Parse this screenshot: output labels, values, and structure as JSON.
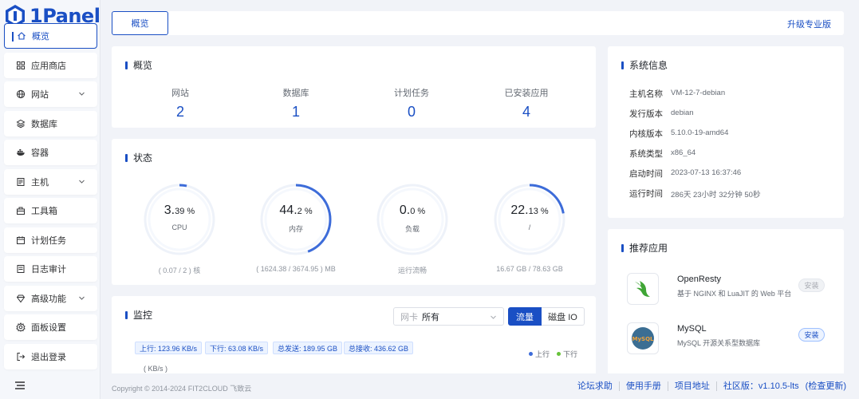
{
  "brand": {
    "name": "1Panel"
  },
  "sidebar": {
    "items": [
      {
        "label": "概览",
        "icon": "home-icon",
        "active": true
      },
      {
        "label": "应用商店",
        "icon": "grid-icon"
      },
      {
        "label": "网站",
        "icon": "globe-icon",
        "expandable": true
      },
      {
        "label": "数据库",
        "icon": "layers-icon"
      },
      {
        "label": "容器",
        "icon": "docker-icon"
      },
      {
        "label": "主机",
        "icon": "host-icon",
        "expandable": true
      },
      {
        "label": "工具箱",
        "icon": "toolbox-icon"
      },
      {
        "label": "计划任务",
        "icon": "calendar-icon"
      },
      {
        "label": "日志审计",
        "icon": "log-icon"
      },
      {
        "label": "高级功能",
        "icon": "diamond-icon",
        "expandable": true
      },
      {
        "label": "面板设置",
        "icon": "gear-icon"
      },
      {
        "label": "退出登录",
        "icon": "logout-icon"
      }
    ]
  },
  "topbar": {
    "tab": "概览",
    "upgrade": "升级专业版"
  },
  "overview": {
    "title": "概览",
    "stats": [
      {
        "label": "网站",
        "value": "2"
      },
      {
        "label": "数据库",
        "value": "1"
      },
      {
        "label": "计划任务",
        "value": "0"
      },
      {
        "label": "已安装应用",
        "value": "4"
      }
    ]
  },
  "status": {
    "title": "状态",
    "gauges": [
      {
        "int": "3.",
        "dec": "39",
        "unit": " %",
        "percent": 3.39,
        "name": "CPU",
        "foot": "( 0.07 / 2 ) 核"
      },
      {
        "int": "44.",
        "dec": "2",
        "unit": " %",
        "percent": 44.2,
        "name": "内存",
        "foot": "( 1624.38 / 3674.95 ) MB"
      },
      {
        "int": "0.",
        "dec": "0",
        "unit": " %",
        "percent": 0,
        "name": "负载",
        "foot": "运行流畅"
      },
      {
        "int": "22.",
        "dec": "13",
        "unit": " %",
        "percent": 22.13,
        "name": "/",
        "foot": "16.67 GB / 78.63 GB"
      }
    ]
  },
  "monitor": {
    "title": "监控",
    "nic_label": "网卡",
    "nic_value": "所有",
    "btn_traffic": "流量",
    "btn_disk": "磁盘 IO",
    "tags": [
      "上行: 123.96 KB/s",
      "下行: 63.08 KB/s",
      "总发送: 189.95 GB",
      "总接收: 436.62 GB"
    ],
    "legend_up": "上行",
    "legend_down": "下行",
    "unit": "( KB/s )",
    "colors": {
      "up": "#3d6cd9",
      "down": "#67c23a"
    }
  },
  "sysinfo": {
    "title": "系统信息",
    "rows": [
      {
        "key": "主机名称",
        "value": "VM-12-7-debian"
      },
      {
        "key": "发行版本",
        "value": "debian"
      },
      {
        "key": "内核版本",
        "value": "5.10.0-19-amd64"
      },
      {
        "key": "系统类型",
        "value": "x86_64"
      },
      {
        "key": "启动时间",
        "value": "2023-07-13 16:37:46"
      },
      {
        "key": "运行时间",
        "value": "286天 23小时 32分钟 50秒"
      }
    ]
  },
  "recommend": {
    "title": "推荐应用",
    "apps": [
      {
        "name": "OpenResty",
        "desc": "基于 NGINX 和 LuaJIT 的 Web 平台",
        "button": "安装",
        "icon": "openresty-icon",
        "disabled": true
      },
      {
        "name": "MySQL",
        "desc": "MySQL 开源关系型数据库",
        "button": "安装",
        "icon": "mysql-icon",
        "disabled": false
      }
    ]
  },
  "footer": {
    "copyright": "Copyright © 2014-2024 FIT2CLOUD 飞致云",
    "links": [
      "论坛求助",
      "使用手册",
      "项目地址",
      "社区版：v1.10.5-lts",
      "(检查更新)"
    ]
  },
  "accent": "#1a4fc4"
}
